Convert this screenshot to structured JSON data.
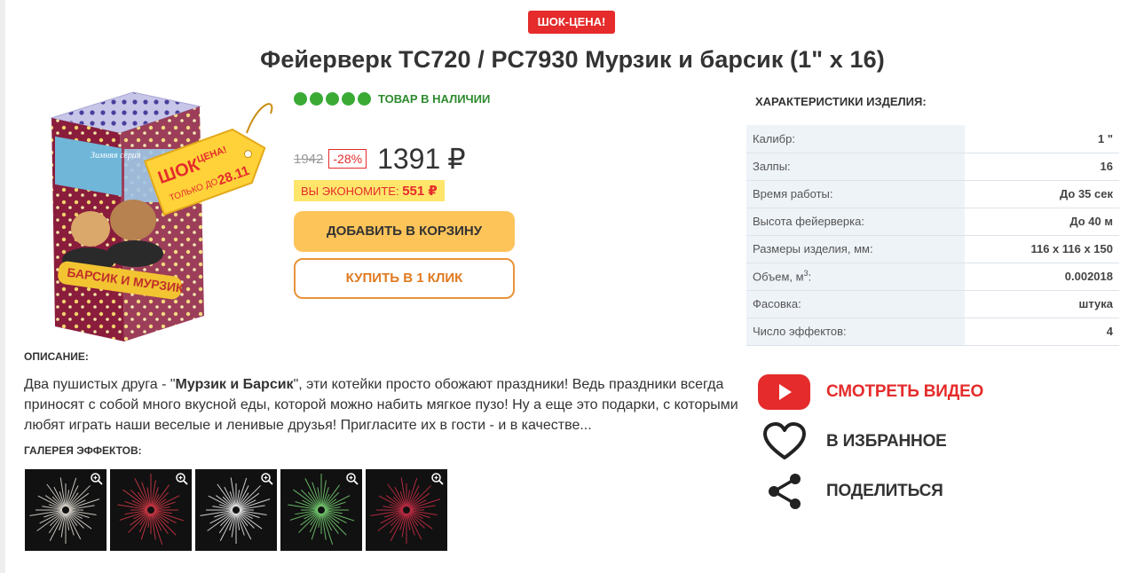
{
  "badge": "ШОК-ЦЕНА!",
  "title": "Фейерверк TC720 / PC7930 Мурзик и барсик (1\" х 16)",
  "product_image": {
    "brand_text": "Зимняя серия",
    "tag_text": "ШОК ЦЕНА! только до 28.11",
    "box_title": "БАРСИК И МУРЗИК"
  },
  "stock": {
    "level": 5,
    "text": "ТОВАР В НАЛИЧИИ"
  },
  "price": {
    "old": "1942",
    "discount": "-28%",
    "current": "1391",
    "currency": "₽",
    "savings_label": "ВЫ ЭКОНОМИТЕ:",
    "savings_value": "551 ₽"
  },
  "buttons": {
    "cart": "ДОБАВИТЬ В КОРЗИНУ",
    "one_click": "КУПИТЬ В 1 КЛИК"
  },
  "specs": {
    "title": "ХАРАКТЕРИСТИКИ ИЗДЕЛИЯ:",
    "rows": [
      {
        "key": "Калибр:",
        "value": "1 \""
      },
      {
        "key": "Залпы:",
        "value": "16"
      },
      {
        "key": "Время работы:",
        "value": "До 35 сек"
      },
      {
        "key": "Высота фейерверка:",
        "value": "До 40 м"
      },
      {
        "key": "Размеры изделия, мм:",
        "value": "116 x 116 x 150"
      },
      {
        "key": "Объем, м",
        "sup": "3",
        "key_suffix": ":",
        "value": "0.002018"
      },
      {
        "key": "Фасовка:",
        "value": "штука"
      },
      {
        "key": "Число эффектов:",
        "value": "4"
      }
    ]
  },
  "description": {
    "title": "ОПИСАНИЕ:",
    "text_before": "Два пушистых друга - \"",
    "text_bold": "Мурзик и Барсик",
    "text_after": "\", эти котейки просто обожают праздники! Ведь праздники всегда приносят с собой много вкусной еды, которой можно набить мягкое пузо! Ну а еще это подарки, с которыми любят играть наши веселые и ленивые друзья! Пригласите их в гости - и в качестве..."
  },
  "gallery": {
    "title": "ГАЛЕРЕЯ ЭФФЕКТОВ:",
    "colors": [
      "#f5f0e6",
      "#e43b4a",
      "#ffffff",
      "#7fe07a",
      "#d9304a"
    ]
  },
  "actions": {
    "video": "СМОТРЕТЬ ВИДЕО",
    "favorite": "В ИЗБРАННОЕ",
    "share": "ПОДЕЛИТЬСЯ"
  },
  "colors": {
    "accent": "#e52b2b",
    "stock": "#3aaa35",
    "cart_button": "#fdc45a",
    "one_click_border": "#e8933a"
  }
}
